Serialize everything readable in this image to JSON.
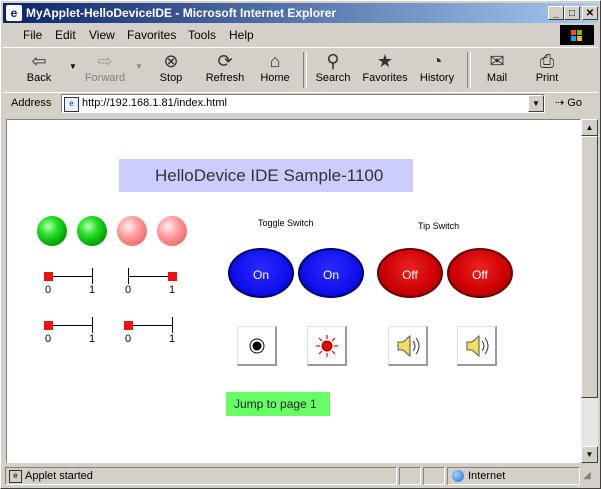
{
  "window": {
    "title": "MyApplet-HelloDeviceIDE - Microsoft Internet Explorer",
    "minimize": "_",
    "maximize": "□",
    "close": "✕"
  },
  "menu": [
    "File",
    "Edit",
    "View",
    "Favorites",
    "Tools",
    "Help"
  ],
  "toolbar": {
    "back": "Back",
    "forward": "Forward",
    "stop": "Stop",
    "refresh": "Refresh",
    "home": "Home",
    "search": "Search",
    "favorites": "Favorites",
    "history": "History",
    "mail": "Mail",
    "print": "Print"
  },
  "address": {
    "label": "Address",
    "url": "http://192.168.1.81/index.html",
    "go": "Go"
  },
  "applet": {
    "header": "HelloDevice IDE Sample-1100",
    "leds": [
      "green",
      "green",
      "pink",
      "pink"
    ],
    "sliders": [
      {
        "min": "0",
        "max": "1",
        "value": 0
      },
      {
        "min": "0",
        "max": "1",
        "value": 1
      },
      {
        "min": "0",
        "max": "1",
        "value": 0
      },
      {
        "min": "0",
        "max": "1",
        "value": 0
      }
    ],
    "toggle_label": "Toggle Switch",
    "tip_label": "Tip Switch",
    "toggle_buttons": [
      "On",
      "On"
    ],
    "tip_buttons": [
      "Off",
      "Off"
    ],
    "jump": "Jump to page 1"
  },
  "status": {
    "text": "Applet started",
    "zone": "Internet"
  }
}
